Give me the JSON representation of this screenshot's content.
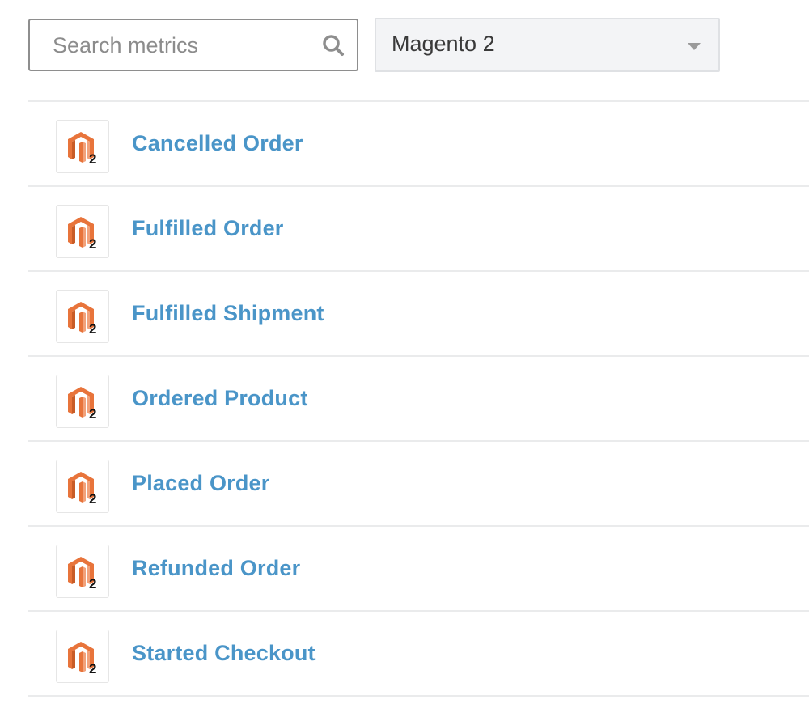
{
  "search": {
    "placeholder": "Search metrics",
    "value": "",
    "icon": "search-icon"
  },
  "source_select": {
    "selected": "Magento 2",
    "icon": "chevron-down-icon"
  },
  "metrics": [
    {
      "label": "Cancelled Order",
      "icon": "magento-2-logo-icon"
    },
    {
      "label": "Fulfilled Order",
      "icon": "magento-2-logo-icon"
    },
    {
      "label": "Fulfilled Shipment",
      "icon": "magento-2-logo-icon"
    },
    {
      "label": "Ordered Product",
      "icon": "magento-2-logo-icon"
    },
    {
      "label": "Placed Order",
      "icon": "magento-2-logo-icon"
    },
    {
      "label": "Refunded Order",
      "icon": "magento-2-logo-icon"
    },
    {
      "label": "Started Checkout",
      "icon": "magento-2-logo-icon"
    }
  ],
  "colors": {
    "link": "#4a95c8",
    "magento_orange": "#e8743b"
  }
}
